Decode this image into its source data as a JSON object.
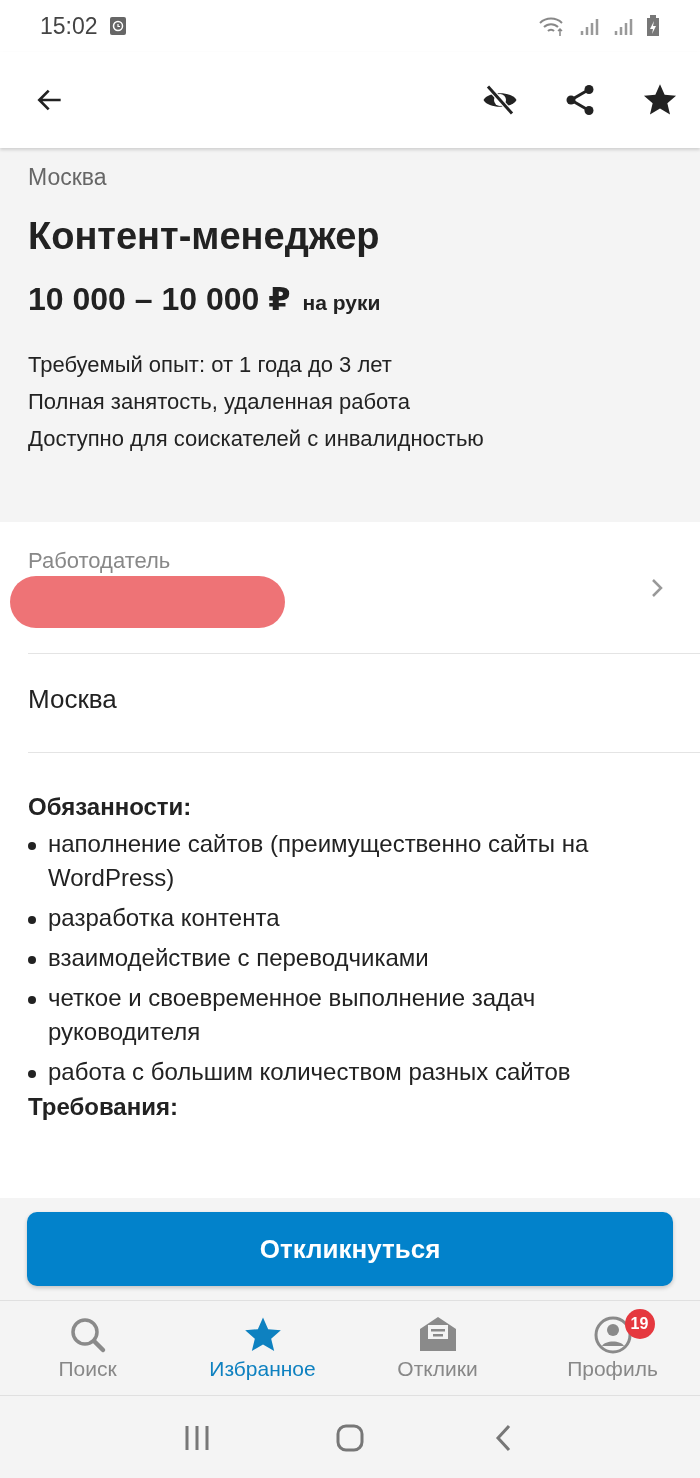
{
  "status_bar": {
    "time": "15:02"
  },
  "vacancy": {
    "city": "Москва",
    "title": "Контент-менеджер",
    "salary": "10 000 – 10 000 ₽",
    "salary_note": "на руки",
    "facts": [
      "Требуемый опыт: от 1 года до 3 лет",
      "Полная занятость, удаленная работа",
      "Доступно для соискателей с инвалидностью"
    ]
  },
  "employer": {
    "label": "Работодатель"
  },
  "address": "Москва",
  "description": {
    "sections": [
      {
        "heading": "Обязанности:",
        "items": [
          "наполнение сайтов (преимущественно сайты на WordPress)",
          "разработка контента",
          "взаимодействие с переводчиками",
          "четкое и своевременное выполнение задач руководителя",
          "работа с большим количеством разных сайтов"
        ]
      },
      {
        "heading": "Требования:"
      }
    ]
  },
  "apply_button": "Откликнуться",
  "bottom_nav": [
    {
      "kind": "search",
      "label": "Поиск",
      "selected": false
    },
    {
      "kind": "star",
      "label": "Избранное",
      "selected": true
    },
    {
      "kind": "mail",
      "label": "Отклики",
      "selected": false
    },
    {
      "kind": "profile",
      "label": "Профиль",
      "selected": false,
      "badge": "19"
    }
  ]
}
